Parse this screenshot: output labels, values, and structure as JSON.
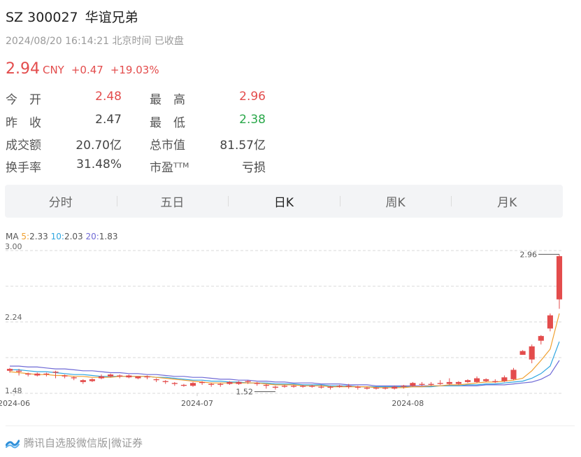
{
  "header": {
    "code": "SZ 300027",
    "name": "华谊兄弟",
    "time": "2024/08/20 16:14:21 北京时间 已收盘"
  },
  "quote": {
    "price": "2.94",
    "currency": "CNY",
    "change": "+0.47",
    "change_pct": "+19.03%"
  },
  "stats": [
    {
      "label": "今　开",
      "value": "2.48",
      "color": "#e34c4c"
    },
    {
      "label": "最　高",
      "value": "2.96",
      "color": "#e34c4c"
    },
    {
      "label": "昨　收",
      "value": "2.47",
      "color": "#444444"
    },
    {
      "label": "最　低",
      "value": "2.38",
      "color": "#2aa84a"
    },
    {
      "label": "成交额",
      "value": "20.70亿",
      "color": "#444444"
    },
    {
      "label": "总市值",
      "value": "81.57亿",
      "color": "#444444"
    },
    {
      "label": "换手率",
      "value": "31.48%",
      "color": "#444444"
    },
    {
      "label": "市盈ᵀᵀᴹ",
      "value": "亏损",
      "color": "#444444"
    }
  ],
  "tabs": [
    "分时",
    "五日",
    "日K",
    "周K",
    "月K"
  ],
  "active_tab": "日K",
  "ma": {
    "label": "MA",
    "ma5_key": "5:",
    "ma5": "2.33",
    "ma10_key": "10:",
    "ma10": "2.03",
    "ma20_key": "20:",
    "ma20": "1.83"
  },
  "colors": {
    "up": "#e34c4c",
    "down": "#2aa84a",
    "ma5": "#f0a030",
    "ma10": "#2fa6e0",
    "ma20": "#6f6ad6"
  },
  "chart_data": {
    "type": "candlestick",
    "y_ticks": [
      "3.00",
      "2.24",
      "1.48"
    ],
    "ylim": [
      1.48,
      3.0
    ],
    "x_labels": [
      {
        "label": "2024-06",
        "index": 0
      },
      {
        "label": "2024-07",
        "index": 20
      },
      {
        "label": "2024-08",
        "index": 43
      }
    ],
    "annotations": [
      {
        "text": "2.96",
        "note": "high"
      },
      {
        "text": "1.52",
        "note": "low"
      }
    ],
    "candles": [
      [
        1.72,
        1.75,
        1.74,
        1.7
      ],
      [
        1.71,
        1.74,
        1.72,
        1.67
      ],
      [
        1.68,
        1.7,
        1.69,
        1.66
      ],
      [
        1.67,
        1.7,
        1.69,
        1.66
      ],
      [
        1.68,
        1.7,
        1.69,
        1.66
      ],
      [
        1.7,
        1.72,
        1.71,
        1.64
      ],
      [
        1.66,
        1.68,
        1.67,
        1.64
      ],
      [
        1.64,
        1.66,
        1.65,
        1.62
      ],
      [
        1.6,
        1.63,
        1.62,
        1.58
      ],
      [
        1.61,
        1.64,
        1.63,
        1.6
      ],
      [
        1.64,
        1.68,
        1.66,
        1.63
      ],
      [
        1.66,
        1.69,
        1.68,
        1.65
      ],
      [
        1.66,
        1.68,
        1.67,
        1.64
      ],
      [
        1.65,
        1.68,
        1.67,
        1.64
      ],
      [
        1.64,
        1.66,
        1.66,
        1.63
      ],
      [
        1.65,
        1.67,
        1.66,
        1.63
      ],
      [
        1.62,
        1.64,
        1.63,
        1.6
      ],
      [
        1.6,
        1.62,
        1.61,
        1.58
      ],
      [
        1.58,
        1.6,
        1.59,
        1.56
      ],
      [
        1.56,
        1.58,
        1.57,
        1.55
      ],
      [
        1.56,
        1.6,
        1.59,
        1.55
      ],
      [
        1.59,
        1.61,
        1.6,
        1.57
      ],
      [
        1.57,
        1.59,
        1.58,
        1.55
      ],
      [
        1.57,
        1.59,
        1.58,
        1.55
      ],
      [
        1.58,
        1.61,
        1.6,
        1.57
      ],
      [
        1.58,
        1.61,
        1.6,
        1.57
      ],
      [
        1.6,
        1.62,
        1.61,
        1.58
      ],
      [
        1.58,
        1.6,
        1.59,
        1.56
      ],
      [
        1.56,
        1.58,
        1.57,
        1.53
      ],
      [
        1.54,
        1.56,
        1.55,
        1.52
      ],
      [
        1.55,
        1.57,
        1.56,
        1.54
      ],
      [
        1.55,
        1.57,
        1.56,
        1.54
      ],
      [
        1.55,
        1.57,
        1.56,
        1.54
      ],
      [
        1.55,
        1.57,
        1.56,
        1.54
      ],
      [
        1.55,
        1.57,
        1.55,
        1.53
      ],
      [
        1.54,
        1.56,
        1.55,
        1.52
      ],
      [
        1.55,
        1.57,
        1.56,
        1.54
      ],
      [
        1.55,
        1.58,
        1.56,
        1.53
      ],
      [
        1.54,
        1.56,
        1.55,
        1.52
      ],
      [
        1.53,
        1.55,
        1.54,
        1.52
      ],
      [
        1.53,
        1.55,
        1.54,
        1.52
      ],
      [
        1.53,
        1.55,
        1.54,
        1.52
      ],
      [
        1.53,
        1.56,
        1.55,
        1.52
      ],
      [
        1.55,
        1.57,
        1.56,
        1.53
      ],
      [
        1.56,
        1.6,
        1.59,
        1.55
      ],
      [
        1.57,
        1.6,
        1.58,
        1.56
      ],
      [
        1.57,
        1.6,
        1.58,
        1.56
      ],
      [
        1.58,
        1.62,
        1.59,
        1.57
      ],
      [
        1.58,
        1.64,
        1.6,
        1.57
      ],
      [
        1.58,
        1.61,
        1.6,
        1.57
      ],
      [
        1.6,
        1.63,
        1.62,
        1.59
      ],
      [
        1.6,
        1.66,
        1.64,
        1.59
      ],
      [
        1.61,
        1.64,
        1.63,
        1.6
      ],
      [
        1.6,
        1.63,
        1.61,
        1.59
      ],
      [
        1.61,
        1.67,
        1.65,
        1.6
      ],
      [
        1.63,
        1.75,
        1.73,
        1.62
      ],
      [
        1.89,
        1.94,
        1.93,
        1.89
      ],
      [
        1.84,
        2.0,
        1.98,
        1.8
      ],
      [
        2.04,
        2.1,
        2.09,
        2.0
      ],
      [
        2.17,
        2.33,
        2.31,
        2.14
      ],
      [
        2.48,
        2.96,
        2.94,
        2.38
      ]
    ],
    "ma5": [
      1.71,
      1.7,
      1.69,
      1.68,
      1.68,
      1.67,
      1.67,
      1.66,
      1.66,
      1.65,
      1.65,
      1.65,
      1.66,
      1.66,
      1.66,
      1.66,
      1.65,
      1.64,
      1.63,
      1.62,
      1.61,
      1.6,
      1.59,
      1.59,
      1.59,
      1.59,
      1.59,
      1.59,
      1.58,
      1.57,
      1.57,
      1.57,
      1.56,
      1.56,
      1.56,
      1.55,
      1.55,
      1.55,
      1.55,
      1.55,
      1.54,
      1.54,
      1.54,
      1.54,
      1.55,
      1.55,
      1.56,
      1.56,
      1.57,
      1.57,
      1.58,
      1.59,
      1.6,
      1.6,
      1.61,
      1.62,
      1.64,
      1.72,
      1.83,
      1.95,
      2.33
    ],
    "ma10": [
      1.73,
      1.73,
      1.72,
      1.71,
      1.71,
      1.7,
      1.69,
      1.68,
      1.68,
      1.67,
      1.66,
      1.66,
      1.66,
      1.66,
      1.66,
      1.66,
      1.65,
      1.65,
      1.64,
      1.63,
      1.62,
      1.62,
      1.61,
      1.61,
      1.6,
      1.6,
      1.59,
      1.59,
      1.59,
      1.58,
      1.58,
      1.58,
      1.57,
      1.57,
      1.57,
      1.56,
      1.56,
      1.56,
      1.55,
      1.55,
      1.55,
      1.55,
      1.55,
      1.55,
      1.55,
      1.55,
      1.55,
      1.56,
      1.56,
      1.56,
      1.57,
      1.57,
      1.58,
      1.58,
      1.59,
      1.6,
      1.61,
      1.64,
      1.69,
      1.77,
      2.03
    ],
    "ma20": [
      1.77,
      1.77,
      1.76,
      1.76,
      1.75,
      1.74,
      1.74,
      1.73,
      1.72,
      1.72,
      1.71,
      1.7,
      1.7,
      1.69,
      1.69,
      1.68,
      1.68,
      1.67,
      1.66,
      1.66,
      1.65,
      1.65,
      1.64,
      1.63,
      1.63,
      1.62,
      1.62,
      1.61,
      1.61,
      1.6,
      1.6,
      1.59,
      1.59,
      1.59,
      1.58,
      1.58,
      1.58,
      1.57,
      1.57,
      1.57,
      1.56,
      1.56,
      1.56,
      1.56,
      1.56,
      1.56,
      1.56,
      1.56,
      1.56,
      1.56,
      1.56,
      1.56,
      1.57,
      1.57,
      1.57,
      1.58,
      1.59,
      1.6,
      1.63,
      1.68,
      1.83
    ]
  },
  "footer": {
    "text": "腾讯自选股微信版|微证券"
  }
}
